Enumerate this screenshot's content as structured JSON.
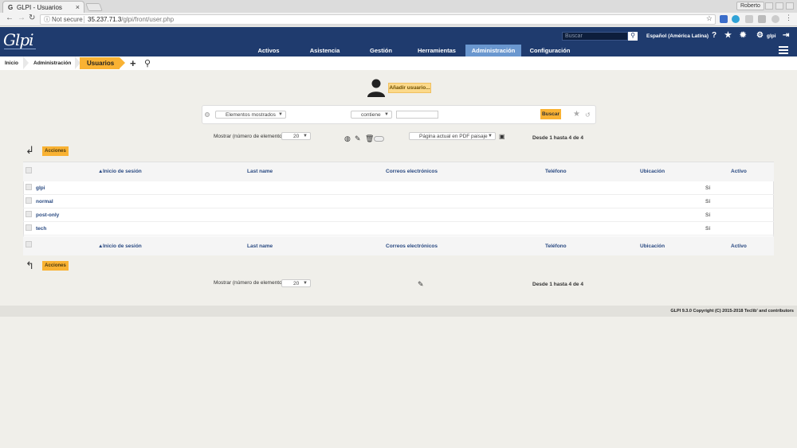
{
  "browser": {
    "tab_title": "GLPI - Usuarios",
    "tab_favicon": "G",
    "profile": "Roberto",
    "security_label": "Not secure",
    "url_host": "35.237.71.3",
    "url_path": "/glpi/front/user.php"
  },
  "header": {
    "logo": "Glpi",
    "search_placeholder": "Buscar",
    "language": "Español (América Latina)",
    "user": "glpi"
  },
  "menu": {
    "items": [
      {
        "label": "Activos"
      },
      {
        "label": "Asistencia"
      },
      {
        "label": "Gestión"
      },
      {
        "label": "Herramientas"
      },
      {
        "label": "Administración"
      },
      {
        "label": "Configuración"
      }
    ],
    "active": "Administración"
  },
  "breadcrumb": {
    "home": "Inicio",
    "section": "Administración",
    "current": "Usuarios"
  },
  "main": {
    "add_user_label": "Añadir usuario..."
  },
  "search": {
    "field_select": "Elementos mostrados",
    "operator_select": "contiene",
    "button": "Buscar"
  },
  "pagination": {
    "show_label": "Mostrar (número de elementos)",
    "page_size": "20",
    "export_select": "Página actual en PDF paisaje",
    "range": "Desde 1 hasta 4 de 4"
  },
  "actions_label": "Acciones",
  "table": {
    "sort_indicator": "▲",
    "columns": [
      "Inicio de sesión",
      "Last name",
      "Correos electrónicos",
      "Teléfono",
      "Ubicación",
      "Activo"
    ],
    "rows": [
      {
        "login": "glpi",
        "active": "Sí"
      },
      {
        "login": "normal",
        "active": "Sí"
      },
      {
        "login": "post-only",
        "active": "Sí"
      },
      {
        "login": "tech",
        "active": "Sí"
      }
    ]
  },
  "footer": "GLPI 9.3.0 Copyright (C) 2015-2018 Teclib' and contributors"
}
